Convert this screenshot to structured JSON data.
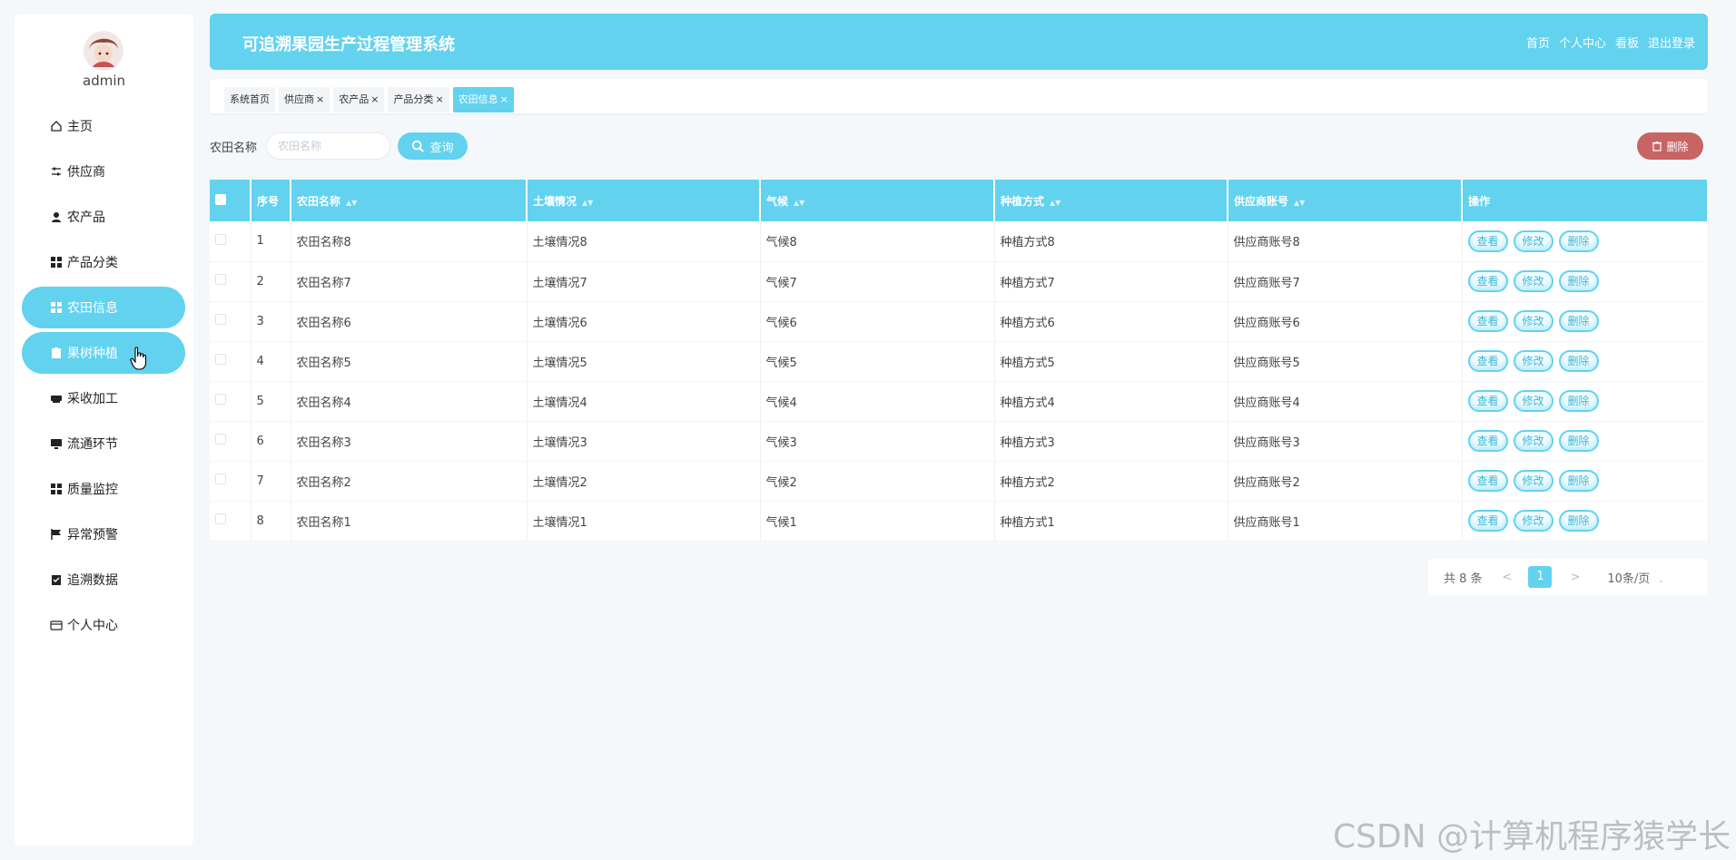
{
  "user": {
    "name": "admin"
  },
  "sidebar": {
    "items": [
      {
        "label": "主页",
        "icon": "home-icon",
        "active": false
      },
      {
        "label": "供应商",
        "icon": "sliders-icon",
        "active": false
      },
      {
        "label": "农产品",
        "icon": "user-icon",
        "active": false
      },
      {
        "label": "产品分类",
        "icon": "grid-icon",
        "active": false
      },
      {
        "label": "农田信息",
        "icon": "grid-icon",
        "active": true
      },
      {
        "label": "果树种植",
        "icon": "clipboard-icon",
        "active": true
      },
      {
        "label": "采收加工",
        "icon": "printer-icon",
        "active": false
      },
      {
        "label": "流通环节",
        "icon": "monitor-icon",
        "active": false
      },
      {
        "label": "质量监控",
        "icon": "grid-icon",
        "active": false
      },
      {
        "label": "异常预警",
        "icon": "flag-icon",
        "active": false
      },
      {
        "label": "追溯数据",
        "icon": "clipboard-check-icon",
        "active": false
      },
      {
        "label": "个人中心",
        "icon": "wallet-icon",
        "active": false
      }
    ]
  },
  "header": {
    "title": "可追溯果园生产过程管理系统",
    "nav": [
      "首页",
      "个人中心",
      "看板",
      "退出登录"
    ]
  },
  "tabs": [
    {
      "label": "系统首页",
      "closable": false,
      "active": false
    },
    {
      "label": "供应商",
      "closable": true,
      "active": false
    },
    {
      "label": "农产品",
      "closable": true,
      "active": false
    },
    {
      "label": "产品分类",
      "closable": true,
      "active": false
    },
    {
      "label": "农田信息",
      "closable": true,
      "active": true
    }
  ],
  "search": {
    "label": "农田名称",
    "placeholder": "农田名称",
    "value": "",
    "button_label": "查询"
  },
  "toolbar": {
    "delete_label": "删除"
  },
  "table": {
    "columns": [
      "序号",
      "农田名称",
      "土壤情况",
      "气候",
      "种植方式",
      "供应商账号",
      "操作"
    ],
    "rows": [
      {
        "index": "1",
        "name": "农田名称8",
        "soil": "土壤情况8",
        "climate": "气候8",
        "method": "种植方式8",
        "supplier": "供应商账号8"
      },
      {
        "index": "2",
        "name": "农田名称7",
        "soil": "土壤情况7",
        "climate": "气候7",
        "method": "种植方式7",
        "supplier": "供应商账号7"
      },
      {
        "index": "3",
        "name": "农田名称6",
        "soil": "土壤情况6",
        "climate": "气候6",
        "method": "种植方式6",
        "supplier": "供应商账号6"
      },
      {
        "index": "4",
        "name": "农田名称5",
        "soil": "土壤情况5",
        "climate": "气候5",
        "method": "种植方式5",
        "supplier": "供应商账号5"
      },
      {
        "index": "5",
        "name": "农田名称4",
        "soil": "土壤情况4",
        "climate": "气候4",
        "method": "种植方式4",
        "supplier": "供应商账号4"
      },
      {
        "index": "6",
        "name": "农田名称3",
        "soil": "土壤情况3",
        "climate": "气候3",
        "method": "种植方式3",
        "supplier": "供应商账号3"
      },
      {
        "index": "7",
        "name": "农田名称2",
        "soil": "土壤情况2",
        "climate": "气候2",
        "method": "种植方式2",
        "supplier": "供应商账号2"
      },
      {
        "index": "8",
        "name": "农田名称1",
        "soil": "土壤情况1",
        "climate": "气候1",
        "method": "种植方式1",
        "supplier": "供应商账号1"
      }
    ],
    "actions": [
      "查看",
      "修改",
      "删除"
    ]
  },
  "pagination": {
    "total_text": "共 8 条",
    "prev": "<",
    "current_page": "1",
    "next": ">",
    "page_size": "10条/页"
  },
  "watermark": "CSDN @计算机程序猿学长",
  "colors": {
    "accent": "#62d2ef",
    "danger": "#c86464",
    "background": "#f4f8fb"
  }
}
